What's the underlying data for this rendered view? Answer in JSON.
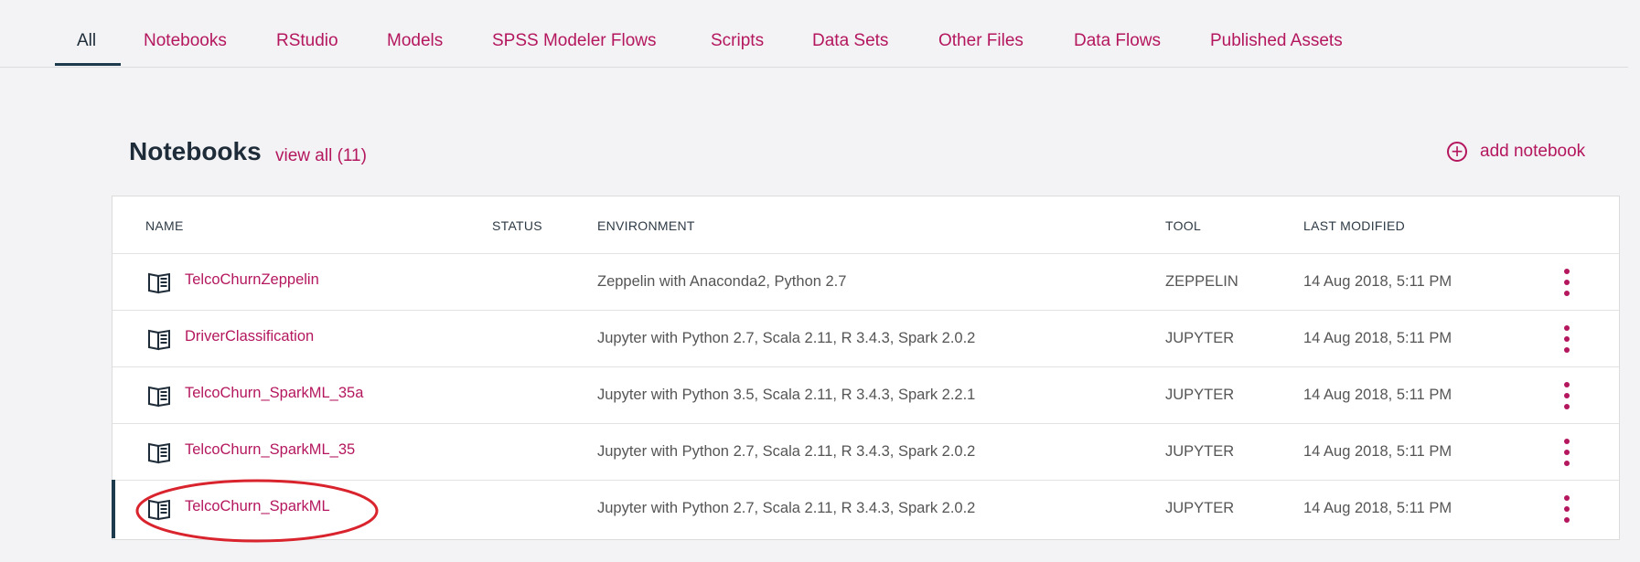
{
  "tabs": [
    {
      "label": "All",
      "active": true
    },
    {
      "label": "Notebooks"
    },
    {
      "label": "RStudio"
    },
    {
      "label": "Models"
    },
    {
      "label": "SPSS Modeler Flows"
    },
    {
      "label": "Scripts"
    },
    {
      "label": "Data Sets"
    },
    {
      "label": "Other Files"
    },
    {
      "label": "Data Flows"
    },
    {
      "label": "Published Assets"
    }
  ],
  "section": {
    "title": "Notebooks",
    "view_all": "view all (11)",
    "add_label": "add notebook"
  },
  "table": {
    "headers": {
      "name": "NAME",
      "status": "STATUS",
      "environment": "ENVIRONMENT",
      "tool": "TOOL",
      "last_modified": "LAST MODIFIED"
    },
    "rows": [
      {
        "name": "TelcoChurnZeppelin",
        "status": "",
        "environment": "Zeppelin with Anaconda2, Python 2.7",
        "tool": "ZEPPELIN",
        "last_modified": "14 Aug 2018, 5:11 PM"
      },
      {
        "name": "DriverClassification",
        "status": "",
        "environment": "Jupyter with Python 2.7, Scala 2.11, R 3.4.3, Spark 2.0.2",
        "tool": "JUPYTER",
        "last_modified": "14 Aug 2018, 5:11 PM"
      },
      {
        "name": "TelcoChurn_SparkML_35a",
        "status": "",
        "environment": "Jupyter with Python 3.5, Scala 2.11, R 3.4.3, Spark 2.2.1",
        "tool": "JUPYTER",
        "last_modified": "14 Aug 2018, 5:11 PM"
      },
      {
        "name": "TelcoChurn_SparkML_35",
        "status": "",
        "environment": "Jupyter with Python 2.7, Scala 2.11, R 3.4.3, Spark 2.0.2",
        "tool": "JUPYTER",
        "last_modified": "14 Aug 2018, 5:11 PM"
      },
      {
        "name": "TelcoChurn_SparkML",
        "status": "",
        "environment": "Jupyter with Python 2.7, Scala 2.11, R 3.4.3, Spark 2.0.2",
        "tool": "JUPYTER",
        "last_modified": "14 Aug 2018, 5:11 PM",
        "selected": true
      }
    ]
  },
  "colors": {
    "accent": "#b4175e",
    "nav_active": "#1e3a4d",
    "annotation": "#d9232d"
  }
}
